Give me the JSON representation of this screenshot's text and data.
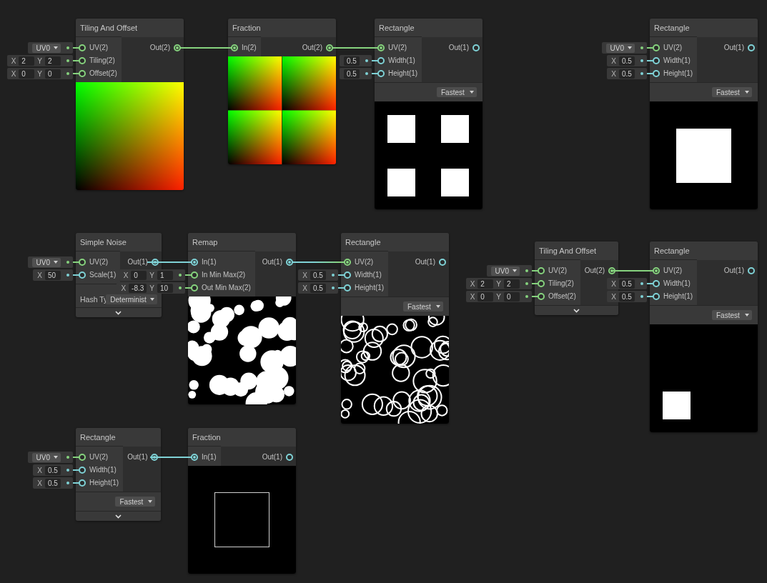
{
  "nodes": [
    {
      "title": "Tiling And Offset",
      "inputs": [
        {
          "label": "UV(2)",
          "color": "#86d37e",
          "connected": false,
          "field": {
            "kind": "dropdown",
            "value": "UV0"
          }
        },
        {
          "label": "Tiling(2)",
          "color": "#86d37e",
          "connected": false,
          "field": {
            "kind": "vector",
            "components": [
              {
                "label": "X",
                "value": "2"
              },
              {
                "label": "Y",
                "value": "2"
              }
            ]
          }
        },
        {
          "label": "Offset(2)",
          "color": "#86d37e",
          "connected": false,
          "field": {
            "kind": "vector",
            "components": [
              {
                "label": "X",
                "value": "0"
              },
              {
                "label": "Y",
                "value": "0"
              }
            ]
          }
        }
      ],
      "outputs": [
        {
          "label": "Out(2)",
          "color": "#86d37e",
          "connected": true
        }
      ],
      "expandable": false
    },
    {
      "title": "Fraction",
      "inputs": [
        {
          "label": "In(2)",
          "color": "#86d37e",
          "connected": true
        }
      ],
      "outputs": [
        {
          "label": "Out(2)",
          "color": "#86d37e",
          "connected": true
        }
      ],
      "expandable": false
    },
    {
      "title": "Rectangle",
      "inputs": [
        {
          "label": "UV(2)",
          "color": "#86d37e",
          "connected": true
        },
        {
          "label": "Width(1)",
          "color": "#7fd2d6",
          "connected": false,
          "field": {
            "kind": "vector",
            "components": [
              {
                "value": "0.5"
              }
            ]
          }
        },
        {
          "label": "Height(1)",
          "color": "#7fd2d6",
          "connected": false,
          "field": {
            "kind": "vector",
            "components": [
              {
                "value": "0.5"
              }
            ]
          }
        }
      ],
      "outputs": [
        {
          "label": "Out(1)",
          "color": "#7fd2d6",
          "connected": false
        }
      ],
      "mode": "Fastest",
      "expandable": false
    },
    {
      "title": "Rectangle",
      "inputs": [
        {
          "label": "UV(2)",
          "color": "#86d37e",
          "connected": false,
          "field": {
            "kind": "dropdown",
            "value": "UV0"
          }
        },
        {
          "label": "Width(1)",
          "color": "#7fd2d6",
          "connected": false,
          "field": {
            "kind": "vector",
            "components": [
              {
                "label": "X",
                "value": "0.5"
              }
            ]
          }
        },
        {
          "label": "Height(1)",
          "color": "#7fd2d6",
          "connected": false,
          "field": {
            "kind": "vector",
            "components": [
              {
                "label": "X",
                "value": "0.5"
              }
            ]
          }
        }
      ],
      "outputs": [
        {
          "label": "Out(1)",
          "color": "#7fd2d6",
          "connected": false
        }
      ],
      "mode": "Fastest",
      "expandable": false
    },
    {
      "title": "Simple Noise",
      "inputs": [
        {
          "label": "UV(2)",
          "color": "#86d37e",
          "connected": false,
          "field": {
            "kind": "dropdown",
            "value": "UV0"
          }
        },
        {
          "label": "Scale(1)",
          "color": "#7fd2d6",
          "connected": false,
          "field": {
            "kind": "vector",
            "components": [
              {
                "label": "X",
                "value": "50"
              }
            ]
          }
        }
      ],
      "outputs": [
        {
          "label": "Out(1)",
          "color": "#7fd2d6",
          "connected": true
        }
      ],
      "settings": [
        {
          "label": "Hash Ty",
          "value": "Determinist"
        }
      ],
      "expandable": true
    },
    {
      "title": "Remap",
      "inputs": [
        {
          "label": "In(1)",
          "color": "#7fd2d6",
          "connected": true
        },
        {
          "label": "In Min Max(2)",
          "color": "#86d37e",
          "connected": false,
          "field": {
            "kind": "vector",
            "components": [
              {
                "label": "X",
                "value": "0"
              },
              {
                "label": "Y",
                "value": "1"
              }
            ]
          }
        },
        {
          "label": "Out Min Max(2)",
          "color": "#86d37e",
          "connected": false,
          "field": {
            "kind": "vector",
            "components": [
              {
                "label": "X",
                "value": "-8.3"
              },
              {
                "label": "Y",
                "value": "10"
              }
            ]
          }
        }
      ],
      "outputs": [
        {
          "label": "Out(1)",
          "color": "#7fd2d6",
          "connected": true
        }
      ],
      "expandable": false
    },
    {
      "title": "Rectangle",
      "inputs": [
        {
          "label": "UV(2)",
          "color": "#86d37e",
          "connected": true
        },
        {
          "label": "Width(1)",
          "color": "#7fd2d6",
          "connected": false,
          "field": {
            "kind": "vector",
            "components": [
              {
                "label": "X",
                "value": "0.5"
              }
            ]
          }
        },
        {
          "label": "Height(1)",
          "color": "#7fd2d6",
          "connected": false,
          "field": {
            "kind": "vector",
            "components": [
              {
                "label": "X",
                "value": "0.5"
              }
            ]
          }
        }
      ],
      "outputs": [
        {
          "label": "Out(1)",
          "color": "#7fd2d6",
          "connected": false
        }
      ],
      "mode": "Fastest",
      "expandable": false
    },
    {
      "title": "Tiling And Offset",
      "inputs": [
        {
          "label": "UV(2)",
          "color": "#86d37e",
          "connected": false,
          "field": {
            "kind": "dropdown",
            "value": "UV0"
          }
        },
        {
          "label": "Tiling(2)",
          "color": "#86d37e",
          "connected": false,
          "field": {
            "kind": "vector",
            "components": [
              {
                "label": "X",
                "value": "2"
              },
              {
                "label": "Y",
                "value": "2"
              }
            ]
          }
        },
        {
          "label": "Offset(2)",
          "color": "#86d37e",
          "connected": false,
          "field": {
            "kind": "vector",
            "components": [
              {
                "label": "X",
                "value": "0"
              },
              {
                "label": "Y",
                "value": "0"
              }
            ]
          }
        }
      ],
      "outputs": [
        {
          "label": "Out(2)",
          "color": "#86d37e",
          "connected": true
        }
      ],
      "expandable": true
    },
    {
      "title": "Rectangle",
      "inputs": [
        {
          "label": "UV(2)",
          "color": "#86d37e",
          "connected": true
        },
        {
          "label": "Width(1)",
          "color": "#7fd2d6",
          "connected": false,
          "field": {
            "kind": "vector",
            "components": [
              {
                "label": "X",
                "value": "0.5"
              }
            ]
          }
        },
        {
          "label": "Height(1)",
          "color": "#7fd2d6",
          "connected": false,
          "field": {
            "kind": "vector",
            "components": [
              {
                "label": "X",
                "value": "0.5"
              }
            ]
          }
        }
      ],
      "outputs": [
        {
          "label": "Out(1)",
          "color": "#7fd2d6",
          "connected": false
        }
      ],
      "mode": "Fastest",
      "expandable": false
    },
    {
      "title": "Rectangle",
      "inputs": [
        {
          "label": "UV(2)",
          "color": "#86d37e",
          "connected": false,
          "field": {
            "kind": "dropdown",
            "value": "UV0"
          }
        },
        {
          "label": "Width(1)",
          "color": "#7fd2d6",
          "connected": false,
          "field": {
            "kind": "vector",
            "components": [
              {
                "label": "X",
                "value": "0.5"
              }
            ]
          }
        },
        {
          "label": "Height(1)",
          "color": "#7fd2d6",
          "connected": false,
          "field": {
            "kind": "vector",
            "components": [
              {
                "label": "X",
                "value": "0.5"
              }
            ]
          }
        }
      ],
      "outputs": [
        {
          "label": "Out(1)",
          "color": "#7fd2d6",
          "connected": true
        }
      ],
      "mode": "Fastest",
      "expandable": true
    },
    {
      "title": "Fraction",
      "inputs": [
        {
          "label": "In(1)",
          "color": "#7fd2d6",
          "connected": true
        }
      ],
      "outputs": [
        {
          "label": "Out(1)",
          "color": "#7fd2d6",
          "connected": false
        }
      ],
      "expandable": false
    }
  ]
}
